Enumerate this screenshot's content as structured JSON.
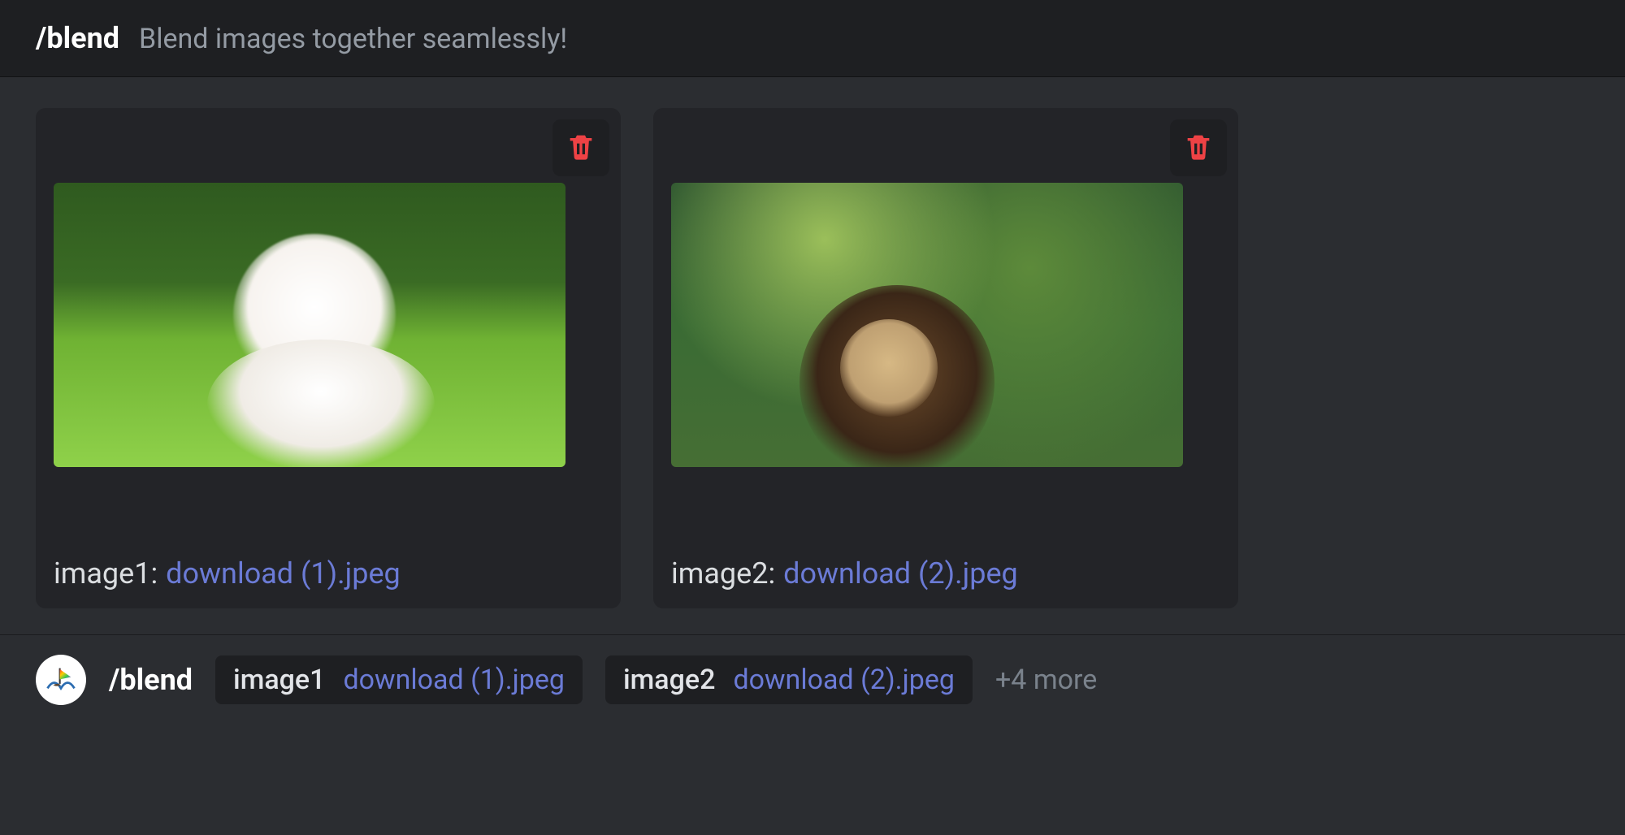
{
  "header": {
    "command": "/blend",
    "description": "Blend images together seamlessly!"
  },
  "cards": [
    {
      "param": "image1:",
      "filename": "download (1).jpeg"
    },
    {
      "param": "image2:",
      "filename": "download (2).jpeg"
    }
  ],
  "input": {
    "command": "/blend",
    "params": [
      {
        "name": "image1",
        "value": "download (1).jpeg"
      },
      {
        "name": "image2",
        "value": "download (2).jpeg"
      }
    ],
    "more": "+4 more"
  }
}
